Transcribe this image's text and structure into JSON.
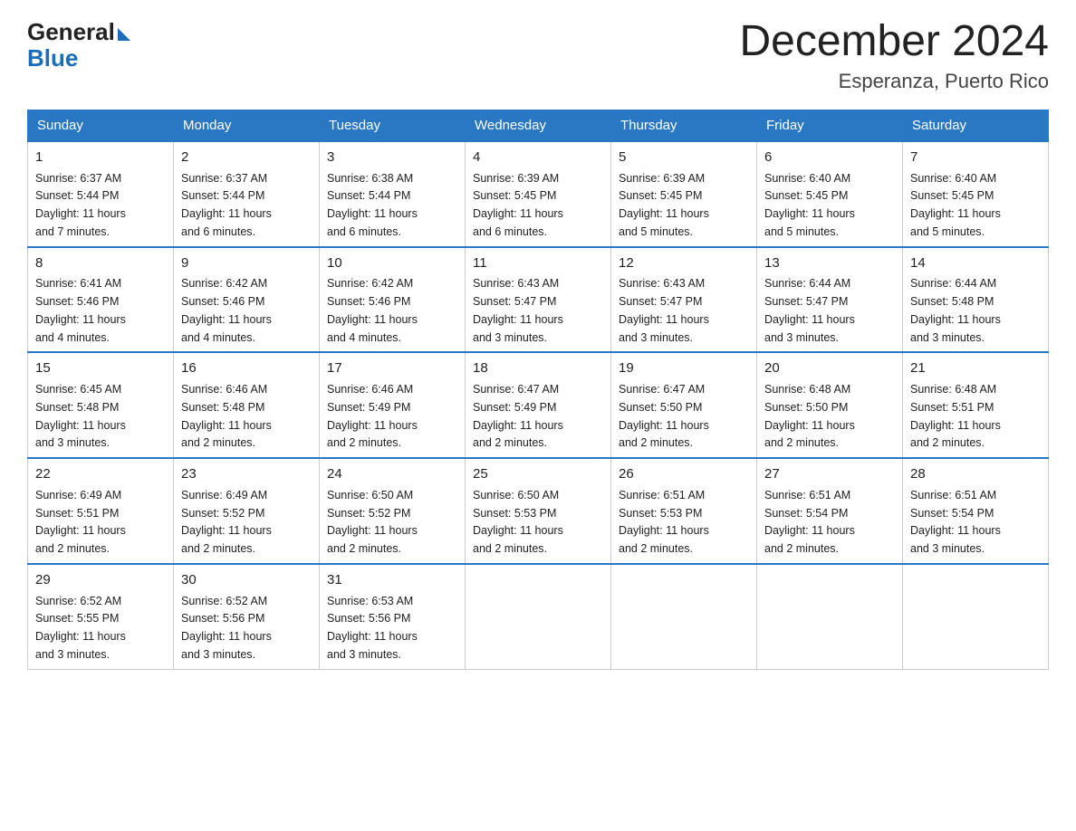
{
  "header": {
    "logo_general": "General",
    "logo_blue": "Blue",
    "month_title": "December 2024",
    "location": "Esperanza, Puerto Rico"
  },
  "weekdays": [
    "Sunday",
    "Monday",
    "Tuesday",
    "Wednesday",
    "Thursday",
    "Friday",
    "Saturday"
  ],
  "weeks": [
    [
      {
        "day": "1",
        "sunrise": "6:37 AM",
        "sunset": "5:44 PM",
        "daylight": "11 hours and 7 minutes."
      },
      {
        "day": "2",
        "sunrise": "6:37 AM",
        "sunset": "5:44 PM",
        "daylight": "11 hours and 6 minutes."
      },
      {
        "day": "3",
        "sunrise": "6:38 AM",
        "sunset": "5:44 PM",
        "daylight": "11 hours and 6 minutes."
      },
      {
        "day": "4",
        "sunrise": "6:39 AM",
        "sunset": "5:45 PM",
        "daylight": "11 hours and 6 minutes."
      },
      {
        "day": "5",
        "sunrise": "6:39 AM",
        "sunset": "5:45 PM",
        "daylight": "11 hours and 5 minutes."
      },
      {
        "day": "6",
        "sunrise": "6:40 AM",
        "sunset": "5:45 PM",
        "daylight": "11 hours and 5 minutes."
      },
      {
        "day": "7",
        "sunrise": "6:40 AM",
        "sunset": "5:45 PM",
        "daylight": "11 hours and 5 minutes."
      }
    ],
    [
      {
        "day": "8",
        "sunrise": "6:41 AM",
        "sunset": "5:46 PM",
        "daylight": "11 hours and 4 minutes."
      },
      {
        "day": "9",
        "sunrise": "6:42 AM",
        "sunset": "5:46 PM",
        "daylight": "11 hours and 4 minutes."
      },
      {
        "day": "10",
        "sunrise": "6:42 AM",
        "sunset": "5:46 PM",
        "daylight": "11 hours and 4 minutes."
      },
      {
        "day": "11",
        "sunrise": "6:43 AM",
        "sunset": "5:47 PM",
        "daylight": "11 hours and 3 minutes."
      },
      {
        "day": "12",
        "sunrise": "6:43 AM",
        "sunset": "5:47 PM",
        "daylight": "11 hours and 3 minutes."
      },
      {
        "day": "13",
        "sunrise": "6:44 AM",
        "sunset": "5:47 PM",
        "daylight": "11 hours and 3 minutes."
      },
      {
        "day": "14",
        "sunrise": "6:44 AM",
        "sunset": "5:48 PM",
        "daylight": "11 hours and 3 minutes."
      }
    ],
    [
      {
        "day": "15",
        "sunrise": "6:45 AM",
        "sunset": "5:48 PM",
        "daylight": "11 hours and 3 minutes."
      },
      {
        "day": "16",
        "sunrise": "6:46 AM",
        "sunset": "5:48 PM",
        "daylight": "11 hours and 2 minutes."
      },
      {
        "day": "17",
        "sunrise": "6:46 AM",
        "sunset": "5:49 PM",
        "daylight": "11 hours and 2 minutes."
      },
      {
        "day": "18",
        "sunrise": "6:47 AM",
        "sunset": "5:49 PM",
        "daylight": "11 hours and 2 minutes."
      },
      {
        "day": "19",
        "sunrise": "6:47 AM",
        "sunset": "5:50 PM",
        "daylight": "11 hours and 2 minutes."
      },
      {
        "day": "20",
        "sunrise": "6:48 AM",
        "sunset": "5:50 PM",
        "daylight": "11 hours and 2 minutes."
      },
      {
        "day": "21",
        "sunrise": "6:48 AM",
        "sunset": "5:51 PM",
        "daylight": "11 hours and 2 minutes."
      }
    ],
    [
      {
        "day": "22",
        "sunrise": "6:49 AM",
        "sunset": "5:51 PM",
        "daylight": "11 hours and 2 minutes."
      },
      {
        "day": "23",
        "sunrise": "6:49 AM",
        "sunset": "5:52 PM",
        "daylight": "11 hours and 2 minutes."
      },
      {
        "day": "24",
        "sunrise": "6:50 AM",
        "sunset": "5:52 PM",
        "daylight": "11 hours and 2 minutes."
      },
      {
        "day": "25",
        "sunrise": "6:50 AM",
        "sunset": "5:53 PM",
        "daylight": "11 hours and 2 minutes."
      },
      {
        "day": "26",
        "sunrise": "6:51 AM",
        "sunset": "5:53 PM",
        "daylight": "11 hours and 2 minutes."
      },
      {
        "day": "27",
        "sunrise": "6:51 AM",
        "sunset": "5:54 PM",
        "daylight": "11 hours and 2 minutes."
      },
      {
        "day": "28",
        "sunrise": "6:51 AM",
        "sunset": "5:54 PM",
        "daylight": "11 hours and 3 minutes."
      }
    ],
    [
      {
        "day": "29",
        "sunrise": "6:52 AM",
        "sunset": "5:55 PM",
        "daylight": "11 hours and 3 minutes."
      },
      {
        "day": "30",
        "sunrise": "6:52 AM",
        "sunset": "5:56 PM",
        "daylight": "11 hours and 3 minutes."
      },
      {
        "day": "31",
        "sunrise": "6:53 AM",
        "sunset": "5:56 PM",
        "daylight": "11 hours and 3 minutes."
      },
      null,
      null,
      null,
      null
    ]
  ],
  "labels": {
    "sunrise": "Sunrise:",
    "sunset": "Sunset:",
    "daylight": "Daylight:"
  }
}
